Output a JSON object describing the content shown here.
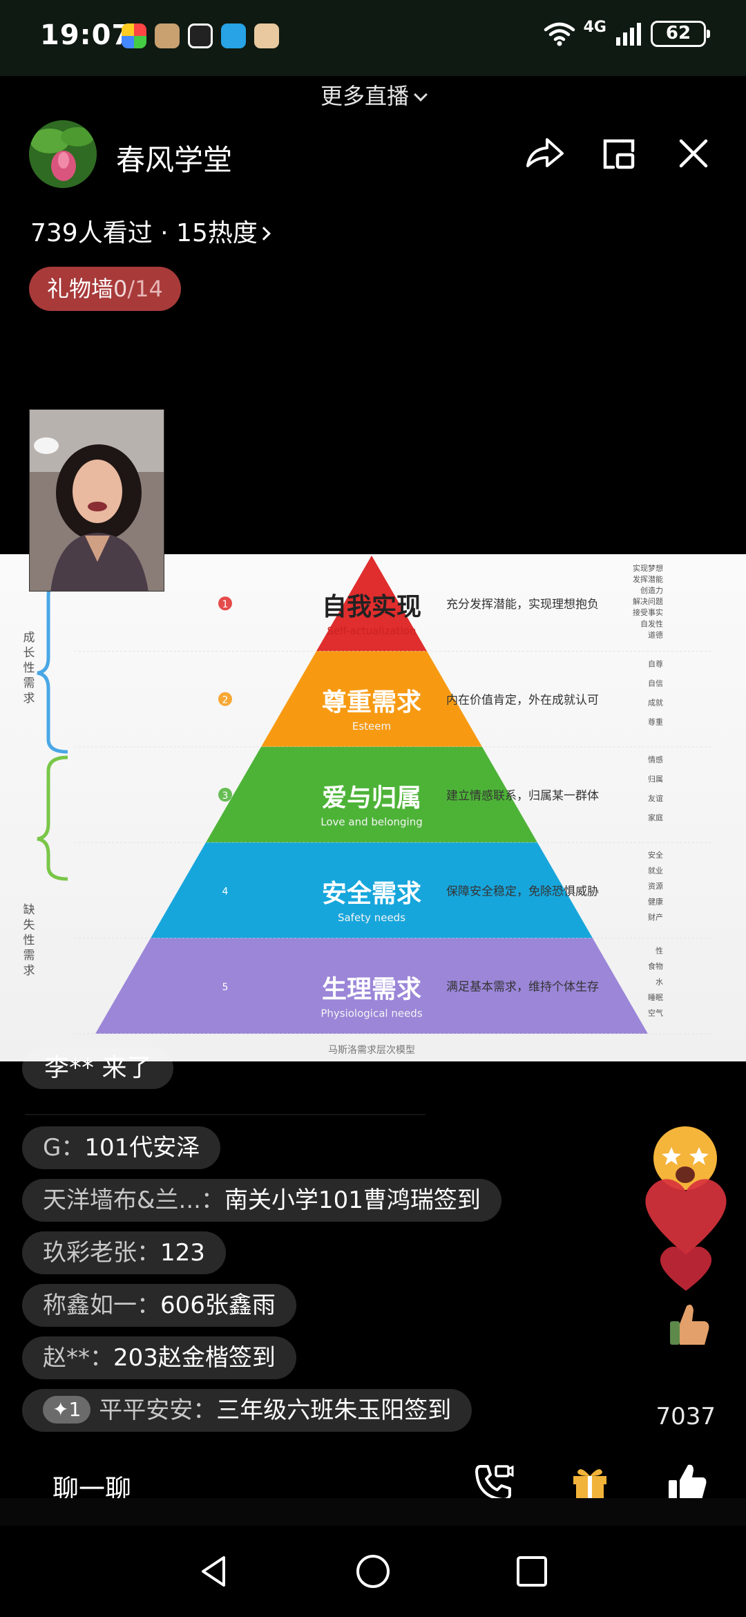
{
  "status_bar": {
    "time": "19:07",
    "network": "4G",
    "battery": "62",
    "app_icons": [
      "app-icon-1",
      "app-icon-2",
      "qq-icon",
      "message-icon",
      "video-icon"
    ]
  },
  "more_live": "更多直播",
  "host": {
    "name": "春风学堂"
  },
  "stats": {
    "text": "739人看过 · 15热度"
  },
  "gift_wall": {
    "label": "礼物墙",
    "count": "0",
    "total": "/14"
  },
  "slide": {
    "caption": "马斯洛需求层次模型",
    "bracket_top": "成长性需求",
    "bracket_bottom": "缺失性需求",
    "levels": [
      {
        "num": "1",
        "cn": "自我实现",
        "en": "Self-actualization",
        "desc": "充分发挥潜能，实现理想抱负",
        "color": "#e02d2d",
        "items": [
          "实现梦想",
          "发挥潜能",
          "创造力",
          "解决问题",
          "接受事实",
          "自发性",
          "道德"
        ]
      },
      {
        "num": "2",
        "cn": "尊重需求",
        "en": "Esteem",
        "desc": "内在价值肯定，外在成就认可",
        "color": "#f79a12",
        "items": [
          "自尊",
          "自信",
          "成就",
          "尊重"
        ]
      },
      {
        "num": "3",
        "cn": "爱与归属",
        "en": "Love and belonging",
        "desc": "建立情感联系，归属某一群体",
        "color": "#4db337",
        "items": [
          "情感",
          "归属",
          "友谊",
          "家庭"
        ]
      },
      {
        "num": "4",
        "cn": "安全需求",
        "en": "Safety needs",
        "desc": "保障安全稳定，免除恐惧威胁",
        "color": "#17a6dc",
        "items": [
          "安全",
          "就业",
          "资源",
          "健康",
          "财产"
        ]
      },
      {
        "num": "5",
        "cn": "生理需求",
        "en": "Physiological needs",
        "desc": "满足基本需求，维持个体生存",
        "color": "#9b86d8",
        "items": [
          "性",
          "食物",
          "水",
          "睡眠",
          "空气"
        ]
      }
    ]
  },
  "arrival": "李** 来了",
  "comments": [
    {
      "user": "G：",
      "msg": "101代安泽"
    },
    {
      "user": "天洋墙布&兰...：",
      "msg": "南关小学101曹鸿瑞签到"
    },
    {
      "user": "玖彩老张：",
      "msg": "123"
    },
    {
      "user": "称鑫如一：",
      "msg": "606张鑫雨"
    },
    {
      "user": "赵**：",
      "msg": "203赵金楷签到"
    },
    {
      "badge": "✦1",
      "user": "平平安安：",
      "msg": "三年级六班朱玉阳签到"
    }
  ],
  "like_count": "7037",
  "bottom": {
    "chat_label": "聊一聊"
  },
  "colors": {
    "gift_wall_bg": "#a83a3a",
    "status_bar_bg": "#0f1a12",
    "like_heart": "#d8333d"
  }
}
